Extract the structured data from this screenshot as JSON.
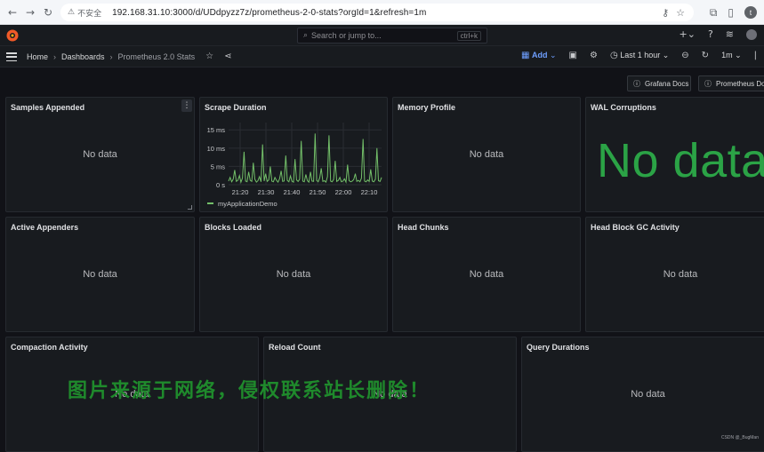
{
  "browser": {
    "back_icon": "arrow-left-icon",
    "forward_icon": "arrow-right-icon",
    "reload_icon": "reload-icon",
    "security_label": "不安全",
    "url": "192.168.31.10:3000/d/UDdpyzz7z/prometheus-2-0-stats?orgId=1&refresh=1m",
    "profile_initial": "t"
  },
  "topbar": {
    "search_placeholder": "Search or jump to...",
    "search_shortcut": "ctrl+k"
  },
  "breadcrumb": {
    "items": [
      "Home",
      "Dashboards",
      "Prometheus 2.0 Stats"
    ],
    "add_label": "Add",
    "time_range": "Last 1 hour",
    "refresh_interval": "1m"
  },
  "links": [
    "Grafana Docs",
    "Prometheus Docs"
  ],
  "panels": {
    "samples_appended": {
      "title": "Samples Appended",
      "status": "No data"
    },
    "scrape_duration": {
      "title": "Scrape Duration"
    },
    "memory_profile": {
      "title": "Memory Profile",
      "status": "No data"
    },
    "wal_corruptions": {
      "title": "WAL Corruptions",
      "status": "No data"
    },
    "active_appenders": {
      "title": "Active Appenders",
      "status": "No data"
    },
    "blocks_loaded": {
      "title": "Blocks Loaded",
      "status": "No data"
    },
    "head_chunks": {
      "title": "Head Chunks",
      "status": "No data"
    },
    "head_block_gc": {
      "title": "Head Block GC Activity",
      "status": "No data"
    },
    "compaction_activity": {
      "title": "Compaction Activity",
      "status": "No data"
    },
    "reload_count": {
      "title": "Reload Count",
      "status": "No data"
    },
    "query_durations": {
      "title": "Query Durations",
      "status": "No data"
    }
  },
  "chart_data": {
    "type": "line",
    "y_ticks": [
      "0 s",
      "5 ms",
      "10 ms",
      "15 ms"
    ],
    "ylim": [
      0,
      17
    ],
    "x_ticks": [
      "21:20",
      "21:30",
      "21:40",
      "21:50",
      "22:00",
      "22:10"
    ],
    "series": [
      {
        "name": "myApplicationDemo",
        "color": "#73bf69",
        "values": [
          1.0,
          2.0,
          0.8,
          1.5,
          4.0,
          0.9,
          1.2,
          2.5,
          0.7,
          1.8,
          9.0,
          1.0,
          0.8,
          3.5,
          1.2,
          0.9,
          6.0,
          1.5,
          0.7,
          1.1,
          2.2,
          0.8,
          11.0,
          1.0,
          3.0,
          0.9,
          1.3,
          5.0,
          1.0,
          0.8,
          2.0,
          1.2,
          0.7,
          1.6,
          3.8,
          0.9,
          1.0,
          8.0,
          1.2,
          0.8,
          2.4,
          1.0,
          0.7,
          7.0,
          1.3,
          0.9,
          1.5,
          12.0,
          1.0,
          0.8,
          2.8,
          1.1,
          0.7,
          3.5,
          1.0,
          0.9,
          14.0,
          1.2,
          0.8,
          1.9,
          4.5,
          0.9,
          1.1,
          0.7,
          2.2,
          13.5,
          1.0,
          0.8,
          1.4,
          6.5,
          0.9,
          1.2,
          2.0,
          0.8,
          1.0,
          1.6,
          0.7,
          5.5,
          1.1,
          0.8,
          1.0,
          1.4,
          3.0,
          0.9,
          1.2,
          0.8,
          1.8,
          12.5,
          1.0,
          0.8,
          1.3,
          0.9,
          4.2,
          1.0,
          0.8,
          1.5,
          10.0,
          1.1,
          0.9,
          2.0
        ]
      }
    ]
  },
  "footer": {
    "watermark": "图片来源于网络，侵权联系站长删除！",
    "credit": "CSDN @_BugMan"
  }
}
